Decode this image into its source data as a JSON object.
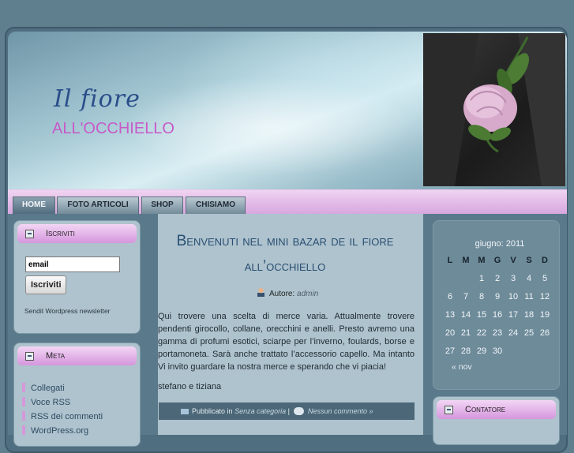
{
  "site": {
    "title_line1": "Il fiore",
    "title_line2": "ALL'OCCHIELLO"
  },
  "nav": {
    "tabs": [
      {
        "label": "HOME",
        "active": true
      },
      {
        "label": "FOTO ARTICOLI"
      },
      {
        "label": "SHOP"
      },
      {
        "label": "CHISIAMO"
      }
    ]
  },
  "sidebar_left": {
    "iscriviti": {
      "heading": "Iscriviti",
      "email_value": "email",
      "button_label": "Iscriviti",
      "sendit_label": "Sendit",
      "newsletter_label": " Wordpress newsletter"
    },
    "meta": {
      "heading": "Meta",
      "links": [
        "Collegati",
        "Voce RSS",
        "RSS dei commenti",
        "WordPress.org"
      ]
    }
  },
  "post": {
    "title": "Benvenuti nel mini bazar de il fiore all’occhiello",
    "author_label": "Autore:",
    "author_name": "admin",
    "body": "Qui trovere una scelta di merce varia. Attualmente trovere pendenti girocollo, collane, orecchini e anelli. Presto avremo una gamma di profumi esotici, sciarpe per l’inverno, foulards, borse e portamoneta. Sarà anche trattato l’accessorio capello. Ma intanto Vi invito guardare la nostra merce e sperando che vi piacia!",
    "signature": "stefano e tiziana",
    "footer_published": "Pubblicato in",
    "footer_category": "Senza categoria",
    "footer_sep": "|",
    "footer_comments": "Nessun commento »"
  },
  "calendar": {
    "caption": "giugno: 2011",
    "weekdays": [
      "L",
      "M",
      "M",
      "G",
      "V",
      "S",
      "D"
    ],
    "weeks": [
      [
        "",
        "",
        "1",
        "2",
        "3",
        "4",
        "5"
      ],
      [
        "6",
        "7",
        "8",
        "9",
        "10",
        "11",
        "12"
      ],
      [
        "13",
        "14",
        "15",
        "16",
        "17",
        "18",
        "19"
      ],
      [
        "20",
        "21",
        "22",
        "23",
        "24",
        "25",
        "26"
      ],
      [
        "27",
        "28",
        "29",
        "30",
        "",
        "",
        ""
      ]
    ],
    "prev_link": "« nov"
  },
  "contatore": {
    "heading": "Contatore"
  }
}
